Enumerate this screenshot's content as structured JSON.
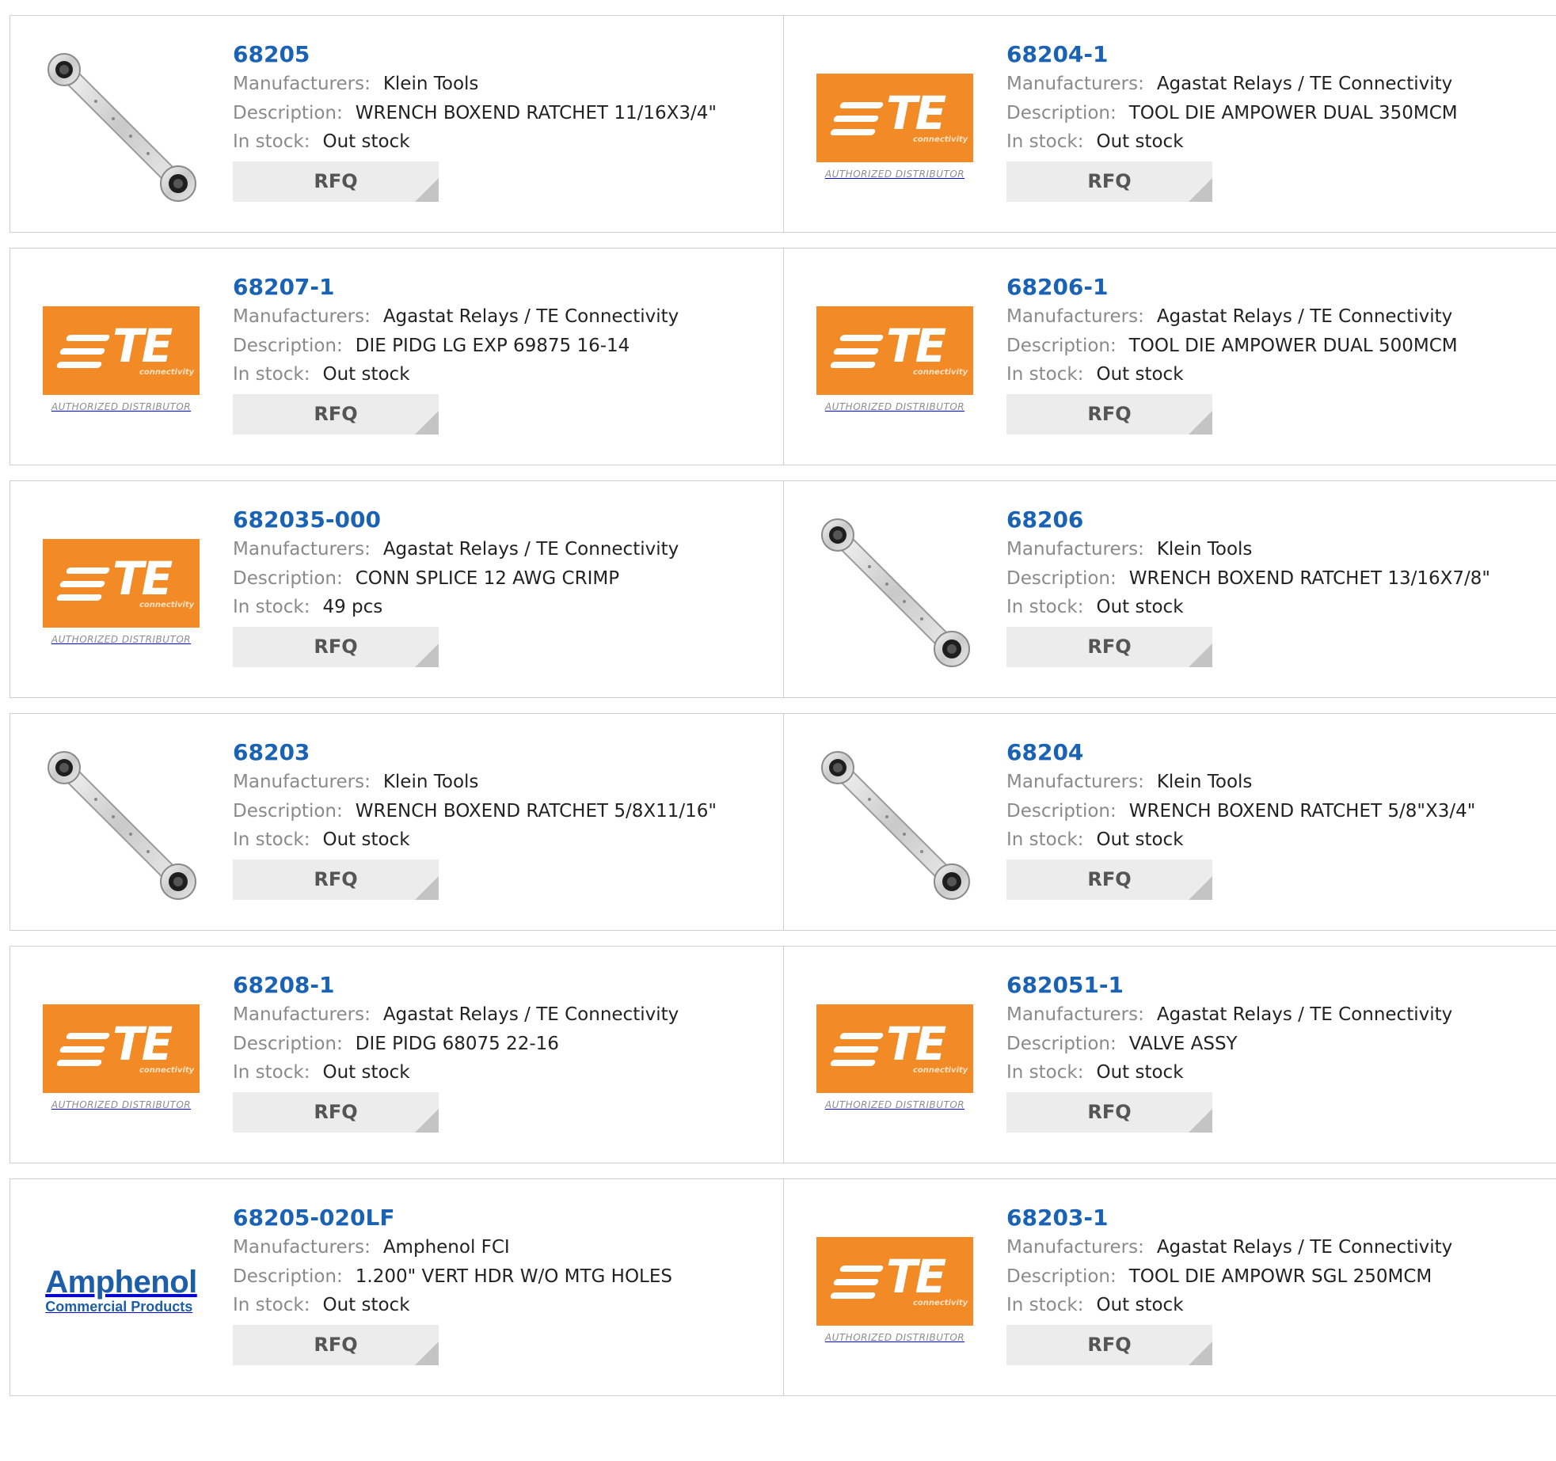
{
  "labels": {
    "manufacturers": "Manufacturers:",
    "description": "Description:",
    "stock": "In stock:",
    "rfq": "RFQ"
  },
  "logos": {
    "te": {
      "text": "TE",
      "sub": "connectivity",
      "authorized": "AUTHORIZED DISTRIBUTOR",
      "color": "#f28a25"
    },
    "amphenol": {
      "name": "Amphenol",
      "sub": "Commercial Products",
      "color": "#1d5ea8"
    }
  },
  "products": [
    {
      "part": "68205",
      "manufacturer": "Klein Tools",
      "description": "WRENCH BOXEND RATCHET 11/16X3/4\"",
      "stock": "Out stock",
      "image": "wrench"
    },
    {
      "part": "68204-1",
      "manufacturer": "Agastat Relays / TE Connectivity",
      "description": "TOOL DIE AMPOWER DUAL 350MCM",
      "stock": "Out stock",
      "image": "te"
    },
    {
      "part": "68207-1",
      "manufacturer": "Agastat Relays / TE Connectivity",
      "description": "DIE PIDG LG EXP 69875 16-14",
      "stock": "Out stock",
      "image": "te"
    },
    {
      "part": "68206-1",
      "manufacturer": "Agastat Relays / TE Connectivity",
      "description": "TOOL DIE AMPOWER DUAL 500MCM",
      "stock": "Out stock",
      "image": "te"
    },
    {
      "part": "682035-000",
      "manufacturer": "Agastat Relays / TE Connectivity",
      "description": "CONN SPLICE 12 AWG CRIMP",
      "stock": "49 pcs",
      "image": "te"
    },
    {
      "part": "68206",
      "manufacturer": "Klein Tools",
      "description": "WRENCH BOXEND RATCHET 13/16X7/8\"",
      "stock": "Out stock",
      "image": "wrench"
    },
    {
      "part": "68203",
      "manufacturer": "Klein Tools",
      "description": "WRENCH BOXEND RATCHET 5/8X11/16\"",
      "stock": "Out stock",
      "image": "wrench"
    },
    {
      "part": "68204",
      "manufacturer": "Klein Tools",
      "description": "WRENCH BOXEND RATCHET 5/8\"X3/4\"",
      "stock": "Out stock",
      "image": "wrench"
    },
    {
      "part": "68208-1",
      "manufacturer": "Agastat Relays / TE Connectivity",
      "description": "DIE PIDG 68075 22-16",
      "stock": "Out stock",
      "image": "te"
    },
    {
      "part": "682051-1",
      "manufacturer": "Agastat Relays / TE Connectivity",
      "description": "VALVE ASSY",
      "stock": "Out stock",
      "image": "te"
    },
    {
      "part": "68205-020LF",
      "manufacturer": "Amphenol FCI",
      "description": "1.200\" VERT HDR W/O MTG HOLES",
      "stock": "Out stock",
      "image": "amphenol"
    },
    {
      "part": "68203-1",
      "manufacturer": "Agastat Relays / TE Connectivity",
      "description": "TOOL DIE AMPOWR SGL 250MCM",
      "stock": "Out stock",
      "image": "te"
    }
  ]
}
